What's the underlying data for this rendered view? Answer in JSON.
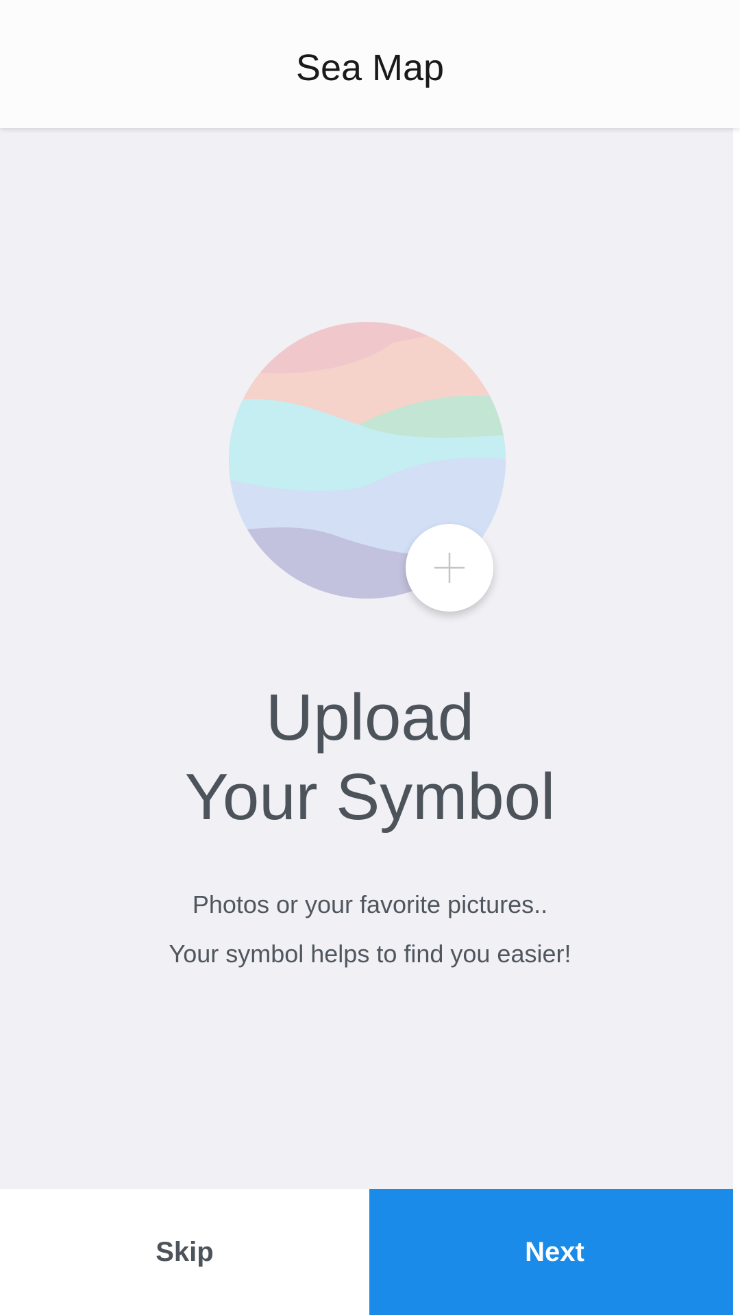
{
  "app_bar": {
    "title": "Sea Map"
  },
  "symbol": {
    "icon": "sea-wave-illustration",
    "add_icon": "plus-icon",
    "colors": {
      "band_top": "#f0c8cc",
      "band_peach": "#f5d2ca",
      "band_green": "#c3e5d4",
      "band_cyan": "#c4eef2",
      "band_blue": "#d2dff5",
      "band_lavender": "#c3c2de"
    }
  },
  "headline": {
    "line1": "Upload",
    "line2": "Your Symbol"
  },
  "description": {
    "line1": "Photos or your favorite pictures..",
    "line2": "Your symbol helps to find you easier!"
  },
  "actions": {
    "skip_label": "Skip",
    "next_label": "Next"
  },
  "colors": {
    "background": "#f0f0f5",
    "accent": "#1a8be8",
    "text": "#4d535b"
  }
}
